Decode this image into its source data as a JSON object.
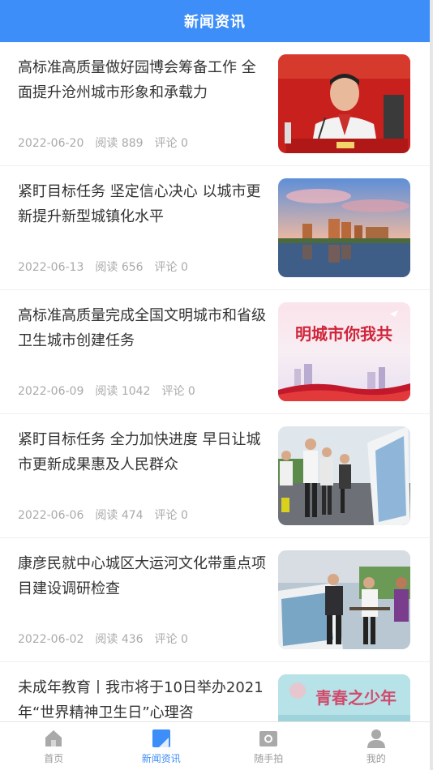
{
  "header": {
    "title": "新闻资讯"
  },
  "theme": {
    "accent": "#3d8ef8",
    "muted": "#aaaaaa",
    "text": "#333333"
  },
  "articles": [
    {
      "title": "高标准高质量做好园博会筹备工作 全面提升沧州城市形象和承载力",
      "date": "2022-06-20",
      "reads": "阅读 889",
      "comments": "评论 0",
      "image": "meeting-speaker-photo"
    },
    {
      "title": "紧盯目标任务 坚定信心决心 以城市更新提升新型城镇化水平",
      "date": "2022-06-13",
      "reads": "阅读 656",
      "comments": "评论 0",
      "image": "city-skyline-photo"
    },
    {
      "title": "高标准高质量完成全国文明城市和省级卫生城市创建任务",
      "date": "2022-06-09",
      "reads": "阅读 1042",
      "comments": "评论 0",
      "image": "civilized-city-banner",
      "image_text": "明城市你我共"
    },
    {
      "title": "紧盯目标任务 全力加快进度 早日让城市更新成果惠及人民群众",
      "date": "2022-06-06",
      "reads": "阅读 474",
      "comments": "评论 0",
      "image": "site-inspection-photo"
    },
    {
      "title": "康彦民就中心城区大运河文化带重点项目建设调研检查",
      "date": "2022-06-02",
      "reads": "阅读 436",
      "comments": "评论 0",
      "image": "canal-project-photo"
    },
    {
      "title": "未成年教育丨我市将于10日举办2021年“世界精神卫生日”心理咨",
      "date": "",
      "reads": "",
      "comments": "",
      "image": "youth-poster",
      "image_text": "青春之少年"
    }
  ],
  "tabbar": [
    {
      "label": "首页",
      "icon": "home-icon",
      "active": false
    },
    {
      "label": "新闻资讯",
      "icon": "news-icon",
      "active": true
    },
    {
      "label": "随手拍",
      "icon": "camera-icon",
      "active": false
    },
    {
      "label": "我的",
      "icon": "user-icon",
      "active": false
    }
  ]
}
